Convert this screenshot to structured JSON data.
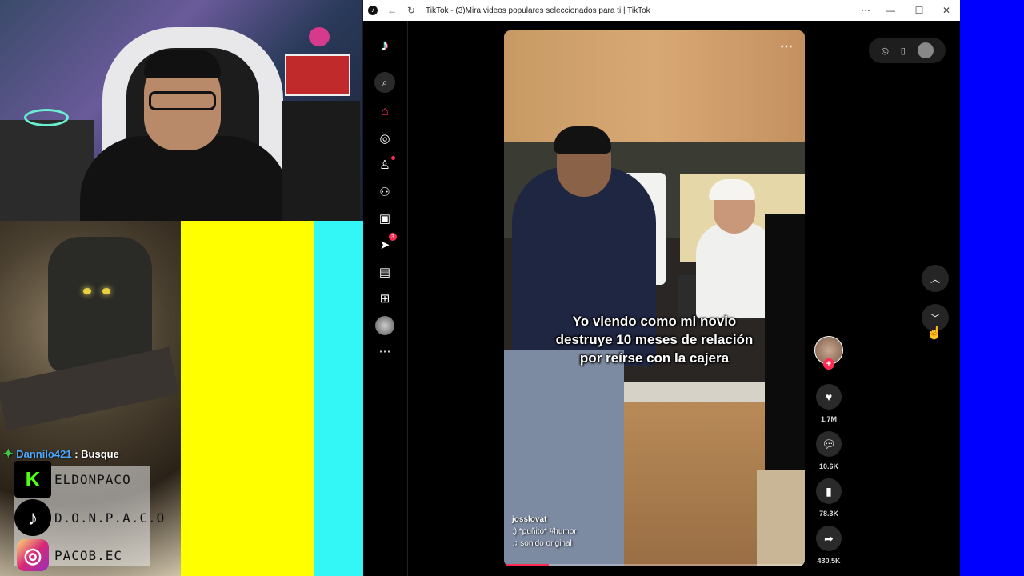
{
  "stream": {
    "chat_message": {
      "user": "Dannilo421",
      "separator": ":",
      "text": "Busque"
    },
    "socials": [
      {
        "platform": "kick",
        "icon": "kick-icon",
        "glyph": "K",
        "handle": "ELDONPACO"
      },
      {
        "platform": "tiktok",
        "icon": "tiktok-icon",
        "glyph": "♪",
        "handle": "D.O.N.P.A.C.O"
      },
      {
        "platform": "instagram",
        "icon": "instagram-icon",
        "glyph": "◎",
        "handle": "PACOB.EC"
      }
    ]
  },
  "browser": {
    "title": "TikTok - (3)Mira videos populares seleccionados para ti | TikTok",
    "controls": {
      "more": "⋯",
      "minimize": "—",
      "maximize": "☐",
      "close": "✕"
    }
  },
  "tiktok": {
    "nav": {
      "messages_badge": "3"
    },
    "video": {
      "caption": "Yo viendo como mi novio destruye 10 meses de relación por reírse con la cajera",
      "author": "josslovat",
      "description": ":) *puñito* #humor",
      "sound": "♫ sonido original",
      "progress": 0.15
    },
    "actions": {
      "likes": "1.7M",
      "comments": "10.6K",
      "saves": "78.3K",
      "shares": "430.5K"
    }
  },
  "colors": {
    "brand": "#fe2c55",
    "panel_yellow": "#ffff00",
    "panel_cyan": "#33f6f6",
    "edge_blue": "#0000ff"
  }
}
